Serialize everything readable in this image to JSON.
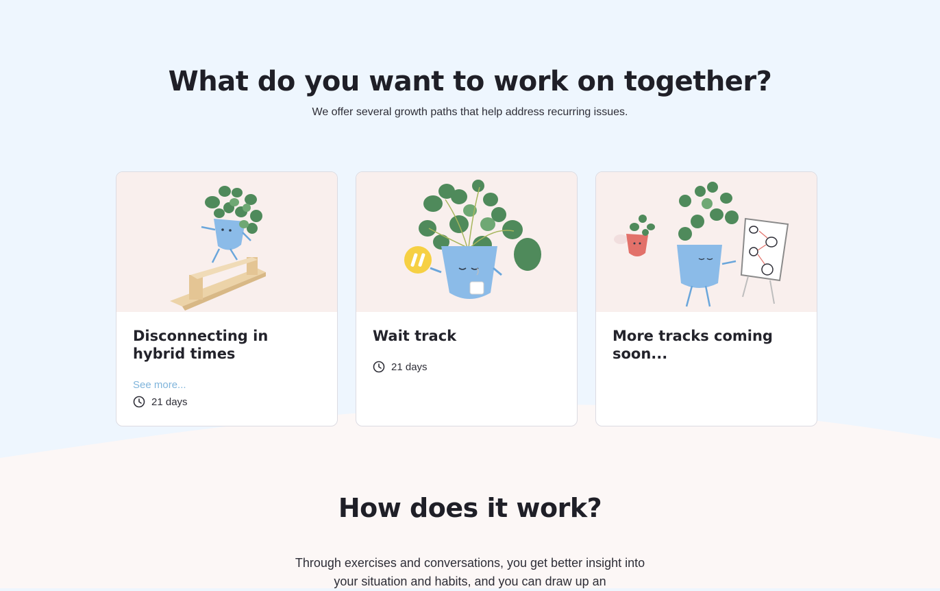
{
  "hero": {
    "title": "What do you want to work on together?",
    "subtitle": "We offer several growth paths that help address recurring issues."
  },
  "tracks": [
    {
      "title": "Disconnecting in hybrid times",
      "see_more": "See more...",
      "duration": "21 days",
      "illustration": "plant-on-balance-beam-illustration"
    },
    {
      "title": "Wait track",
      "duration": "21 days",
      "illustration": "plant-with-pause-coin-illustration"
    },
    {
      "title": "More tracks coming soon...",
      "illustration": "plants-with-whiteboard-illustration"
    }
  ],
  "how": {
    "title": "How does it work?",
    "body": "Through exercises and conversations, you get better insight into your situation and habits, and you can draw up an"
  },
  "icons": {
    "duration": "clock-icon"
  },
  "colors": {
    "sky_background": "#eef6fe",
    "sand_background": "#fcf7f6",
    "card_illustration_bg": "#f9efed",
    "link": "#7fb4db",
    "pot_blue": "#8bbbe8",
    "leaf_green": "#4f8a5b",
    "pot_red": "#e2716a",
    "coin_yellow": "#f6d043"
  }
}
